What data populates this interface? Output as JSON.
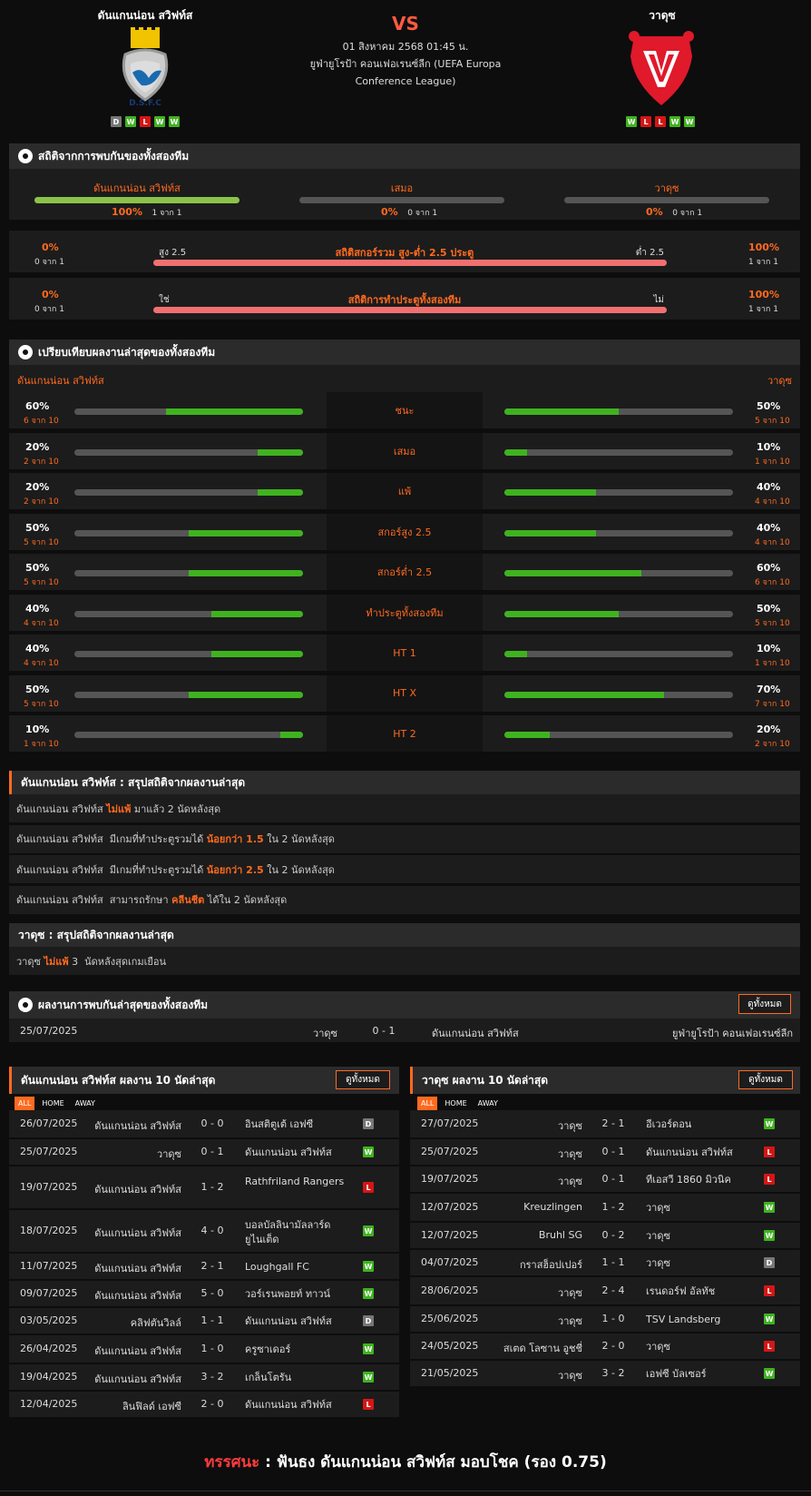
{
  "header": {
    "home_name": "ดันแกนน่อน สวิฟท์ส",
    "away_name": "วาดุซ",
    "vs": "VS",
    "date": "01 สิงหาคม 2568 01:45 น.",
    "competition_line1": "ยูฟ่ายูโรป้า คอนเฟอเรนซ์ลีก (UEFA Europa",
    "competition_line2": "Conference League)",
    "home_form": [
      "D",
      "W",
      "L",
      "W",
      "W"
    ],
    "away_form": [
      "W",
      "L",
      "L",
      "W",
      "W"
    ],
    "home_crest_text": "D.S.F.C"
  },
  "h2h": {
    "title": "สถิติจากการพบกันของทั้งสองทีม",
    "cols": [
      {
        "label": "ดันแกนน่อน สวิฟท์ส",
        "pct": "100%",
        "sub": "1 จาก 1",
        "fill": 1.0
      },
      {
        "label": "เสมอ",
        "pct": "0%",
        "sub": "0 จาก 1",
        "fill": 0
      },
      {
        "label": "วาดุซ",
        "pct": "0%",
        "sub": "0 จาก 1",
        "fill": 0
      }
    ],
    "ou": {
      "left_pct": "0%",
      "left_sub": "0 จาก 1",
      "left_label": "สูง 2.5",
      "title": "สถิติสกอร์รวม สูง-ต่ำ 2.5 ประตู",
      "right_label": "ต่ำ 2.5",
      "right_pct": "100%",
      "right_sub": "1 จาก 1"
    },
    "btts": {
      "left_pct": "0%",
      "left_sub": "0 จาก 1",
      "left_label": "ใช่",
      "title": "สถิติการทำประตูทั้งสองทีม",
      "right_label": "ไม่",
      "right_pct": "100%",
      "right_sub": "1 จาก 1"
    }
  },
  "compare": {
    "title": "เปรียบเทียบผลงานล่าสุดของทั้งสองทีม",
    "home": "ดันแกนน่อน สวิฟท์ส",
    "away": "วาดุซ",
    "rows": [
      {
        "label": "ชนะ",
        "hp": "60%",
        "hs": "6 จาก 10",
        "hv": 0.6,
        "ap": "50%",
        "as": "5 จาก 10",
        "av": 0.5
      },
      {
        "label": "เสมอ",
        "hp": "20%",
        "hs": "2 จาก 10",
        "hv": 0.2,
        "ap": "10%",
        "as": "1 จาก 10",
        "av": 0.1
      },
      {
        "label": "แพ้",
        "hp": "20%",
        "hs": "2 จาก 10",
        "hv": 0.2,
        "ap": "40%",
        "as": "4 จาก 10",
        "av": 0.4
      },
      {
        "label": "สกอร์สูง 2.5",
        "hp": "50%",
        "hs": "5 จาก 10",
        "hv": 0.5,
        "ap": "40%",
        "as": "4 จาก 10",
        "av": 0.4
      },
      {
        "label": "สกอร์ต่ำ 2.5",
        "hp": "50%",
        "hs": "5 จาก 10",
        "hv": 0.5,
        "ap": "60%",
        "as": "6 จาก 10",
        "av": 0.6
      },
      {
        "label": "ทำประตูทั้งสองทีม",
        "hp": "40%",
        "hs": "4 จาก 10",
        "hv": 0.4,
        "ap": "50%",
        "as": "5 จาก 10",
        "av": 0.5
      },
      {
        "label": "HT 1",
        "hp": "40%",
        "hs": "4 จาก 10",
        "hv": 0.4,
        "ap": "10%",
        "as": "1 จาก 10",
        "av": 0.1
      },
      {
        "label": "HT X",
        "hp": "50%",
        "hs": "5 จาก 10",
        "hv": 0.5,
        "ap": "70%",
        "as": "7 จาก 10",
        "av": 0.7
      },
      {
        "label": "HT 2",
        "hp": "10%",
        "hs": "1 จาก 10",
        "hv": 0.1,
        "ap": "20%",
        "as": "2 จาก 10",
        "av": 0.2
      }
    ]
  },
  "home_summary": {
    "title": "ดันแกนน่อน สวิฟท์ส : สรุปสถิติจากผลงานล่าสุด",
    "rows": [
      {
        "a": "ดันแกนน่อน สวิฟท์ส ",
        "b": "ไม่แพ้",
        "c": " มาแล้ว 2 นัดหลังสุด"
      },
      {
        "a": "ดันแกนน่อน สวิฟท์ส  มีเกมที่ทำประตูรวมได้ ",
        "b": "น้อยกว่า 1.5",
        "c": " ใน 2 นัดหลังสุด"
      },
      {
        "a": "ดันแกนน่อน สวิฟท์ส  มีเกมที่ทำประตูรวมได้ ",
        "b": "น้อยกว่า 2.5",
        "c": " ใน 2 นัดหลังสุด"
      },
      {
        "a": "ดันแกนน่อน สวิฟท์ส  สามารถรักษา ",
        "b": "คลีนชีต",
        "c": " ได้ใน 2 นัดหลังสุด"
      }
    ]
  },
  "away_summary": {
    "title": "วาดุซ : สรุปสถิติจากผลงานล่าสุด",
    "rows": [
      {
        "a": "วาดุซ ",
        "b": "ไม่แพ้",
        "c": " 3  นัดหลังสุดเกมเยือน"
      }
    ]
  },
  "h2h_results": {
    "title": "ผลงานการพบกันล่าสุดของทั้งสองทีม",
    "btn": "ดูทั้งหมด",
    "rows": [
      {
        "date": "25/07/2025",
        "home": "วาดุซ",
        "score": "0 - 1",
        "away": "ดันแกนน่อน สวิฟท์ส",
        "comp": "ยูฟ่ายูโรป้า คอนเฟอเรนซ์ลีก"
      }
    ]
  },
  "home_last10": {
    "title": "ดันแกนน่อน สวิฟท์ส ผลงาน 10 นัดล่าสุด",
    "btn": "ดูทั้งหมด",
    "tabs": [
      "ALL",
      "HOME",
      "AWAY"
    ],
    "rows": [
      {
        "date": "26/07/2025",
        "home": "ดันแกนน่อน สวิฟท์ส",
        "score": "0 - 0",
        "away": "อินสติตูเต้ เอฟซี",
        "r": "D"
      },
      {
        "date": "25/07/2025",
        "home": "วาดุซ",
        "score": "0 - 1",
        "away": "ดันแกนน่อน สวิฟท์ส",
        "r": "W"
      },
      {
        "date": "19/07/2025",
        "home": "ดันแกนน่อน สวิฟท์ส",
        "score": "1 - 2",
        "away": "Rathfriland Rangers",
        "r": "L"
      },
      {
        "date": "18/07/2025",
        "home": "ดันแกนน่อน สวิฟท์ส",
        "score": "4 - 0",
        "away": "บอลบัลลินามัลลาร์ด ยูไนเต็ด",
        "r": "W"
      },
      {
        "date": "11/07/2025",
        "home": "ดันแกนน่อน สวิฟท์ส",
        "score": "2 - 1",
        "away": "Loughgall FC",
        "r": "W"
      },
      {
        "date": "09/07/2025",
        "home": "ดันแกนน่อน สวิฟท์ส",
        "score": "5 - 0",
        "away": "วอร์เรนพอยท์ ทาวน์",
        "r": "W"
      },
      {
        "date": "03/05/2025",
        "home": "คลิฟตันวิลล์",
        "score": "1 - 1",
        "away": "ดันแกนน่อน สวิฟท์ส",
        "r": "D"
      },
      {
        "date": "26/04/2025",
        "home": "ดันแกนน่อน สวิฟท์ส",
        "score": "1 - 0",
        "away": "ครูซาเดอร์",
        "r": "W"
      },
      {
        "date": "19/04/2025",
        "home": "ดันแกนน่อน สวิฟท์ส",
        "score": "3 - 2",
        "away": "เกล็นโตรัน",
        "r": "W"
      },
      {
        "date": "12/04/2025",
        "home": "ลินฟิลด์ เอฟซี",
        "score": "2 - 0",
        "away": "ดันแกนน่อน สวิฟท์ส",
        "r": "L"
      }
    ]
  },
  "away_last10": {
    "title": "วาดุซ ผลงาน 10 นัดล่าสุด",
    "btn": "ดูทั้งหมด",
    "tabs": [
      "ALL",
      "HOME",
      "AWAY"
    ],
    "rows": [
      {
        "date": "27/07/2025",
        "home": "วาดุซ",
        "score": "2 - 1",
        "away": "อีเวอร์ดอน",
        "r": "W"
      },
      {
        "date": "25/07/2025",
        "home": "วาดุซ",
        "score": "0 - 1",
        "away": "ดันแกนน่อน สวิฟท์ส",
        "r": "L"
      },
      {
        "date": "19/07/2025",
        "home": "วาดุซ",
        "score": "0 - 1",
        "away": "ทีเอสวี 1860 มิวนิค",
        "r": "L"
      },
      {
        "date": "12/07/2025",
        "home": "Kreuzlingen",
        "score": "1 - 2",
        "away": "วาดุซ",
        "r": "W"
      },
      {
        "date": "12/07/2025",
        "home": "Bruhl SG",
        "score": "0 - 2",
        "away": "วาดุซ",
        "r": "W"
      },
      {
        "date": "04/07/2025",
        "home": "กราสฮ็อปเปอร์",
        "score": "1 - 1",
        "away": "วาดุซ",
        "r": "D"
      },
      {
        "date": "28/06/2025",
        "home": "วาดุซ",
        "score": "2 - 4",
        "away": "เรนดอร์ฟ อัลทัช",
        "r": "L"
      },
      {
        "date": "25/06/2025",
        "home": "วาดุซ",
        "score": "1 - 0",
        "away": "TSV Landsberg",
        "r": "W"
      },
      {
        "date": "24/05/2025",
        "home": "สเตด โลซาน อูชชี่",
        "score": "2 - 0",
        "away": "วาดุซ",
        "r": "L"
      },
      {
        "date": "21/05/2025",
        "home": "วาดุซ",
        "score": "3 - 2",
        "away": "เอฟซี บัลเซอร์",
        "r": "W"
      }
    ]
  },
  "prediction": {
    "label": "ทรรศนะ",
    "colon": " : ",
    "text": "ฟันธง ดันแกนน่อน สวิฟท์ส มอบโชค (รอง 0.75)"
  },
  "colors": {
    "accent": "#ff6a1f",
    "green": "#3fb31f",
    "red": "#d41616",
    "pink_bar": "#f07070"
  }
}
